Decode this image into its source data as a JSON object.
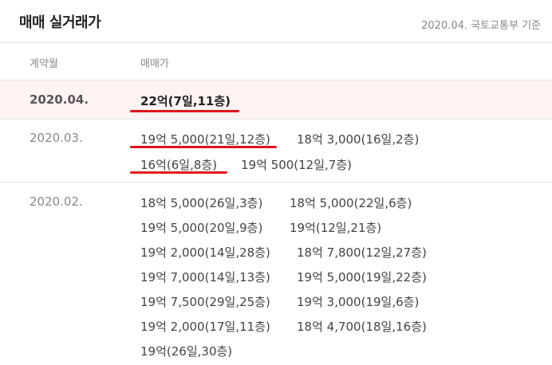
{
  "header": {
    "title": "매매 실거래가",
    "source": "2020.04. 국토교통부 기준"
  },
  "columns": {
    "month": "계약월",
    "price": "매매가"
  },
  "rows": [
    {
      "month": "2020.04.",
      "deals": [
        "22억(7일,11층)"
      ]
    },
    {
      "month": "2020.03.",
      "deals": [
        "19억 5,000(21일,12층)",
        "18억 3,000(16일,2층)",
        "16억(6일,8층)",
        "19억 500(12일,7층)"
      ]
    },
    {
      "month": "2020.02.",
      "deals": [
        "18억 5,000(26일,3층)",
        "18억 5,000(22일,6층)",
        "19억 5,000(20일,9층)",
        "19억(12일,21층)",
        "19억 2,000(14일,28층)",
        "18억 7,800(12일,27층)",
        "19억 7,000(14일,13층)",
        "19억 5,000(19일,22층)",
        "19억 7,500(29일,25층)",
        "19억 3,000(19일,6층)",
        "19억 2,000(17일,11층)",
        "18억 4,700(18일,16층)",
        "19억(26일,30층)"
      ]
    }
  ]
}
